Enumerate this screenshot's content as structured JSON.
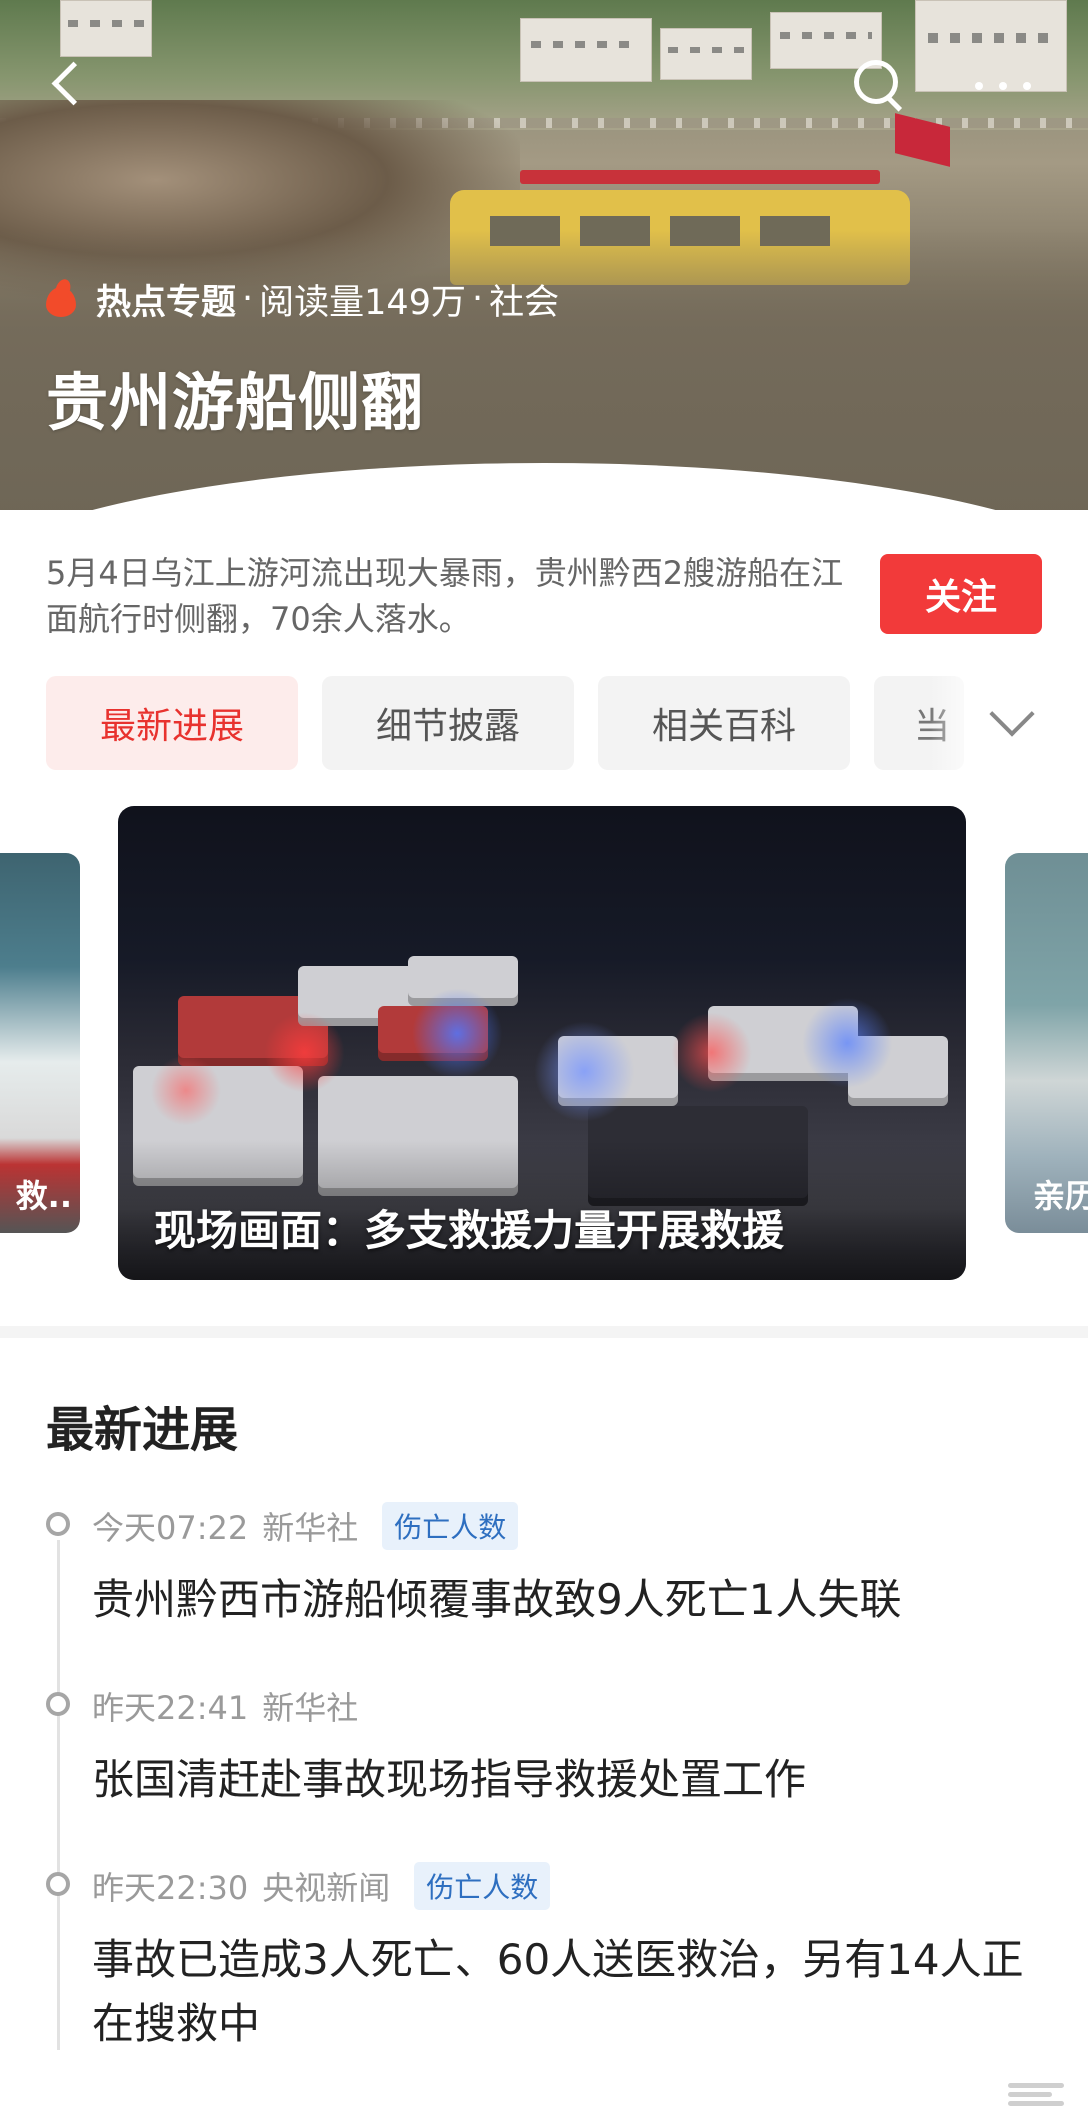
{
  "topic": {
    "label": "热点专题",
    "dot1": "·",
    "reads": "阅读量149万",
    "dot2": "·",
    "category": "社会",
    "title": "贵州游船侧翻",
    "description": "5月4日乌江上游河流出现大暴雨，贵州黔西2艘游船在江面航行时侧翻，70余人落水。",
    "follow_label": "关注"
  },
  "tabs": [
    {
      "label": "最新进展",
      "active": true
    },
    {
      "label": "细节披露",
      "active": false
    },
    {
      "label": "相关百科",
      "active": false
    },
    {
      "label": "当",
      "active": false
    }
  ],
  "carousel": {
    "left_caption": "救..",
    "main_caption": "现场画面：多支救援力量开展救援",
    "right_caption": "亲历"
  },
  "latest": {
    "section_title": "最新进展",
    "items": [
      {
        "time": "今天07:22",
        "source": "新华社",
        "tag": "伤亡人数",
        "headline": "贵州黔西市游船倾覆事故致9人死亡1人失联"
      },
      {
        "time": "昨天22:41",
        "source": "新华社",
        "tag": "",
        "headline": "张国清赶赴事故现场指导救援处置工作"
      },
      {
        "time": "昨天22:30",
        "source": "央视新闻",
        "tag": "伤亡人数",
        "headline": "事故已造成3人死亡、60人送医救治，另有14人正在搜救中"
      }
    ]
  },
  "colors": {
    "accent_red": "#f23a3a",
    "tab_active_bg": "#fdeceb",
    "tag_bg": "#e8f1fb",
    "tag_text": "#2e6fc0"
  },
  "icons": [
    "back-arrow-icon",
    "search-icon",
    "more-icon",
    "flame-icon",
    "chevron-down-icon"
  ]
}
